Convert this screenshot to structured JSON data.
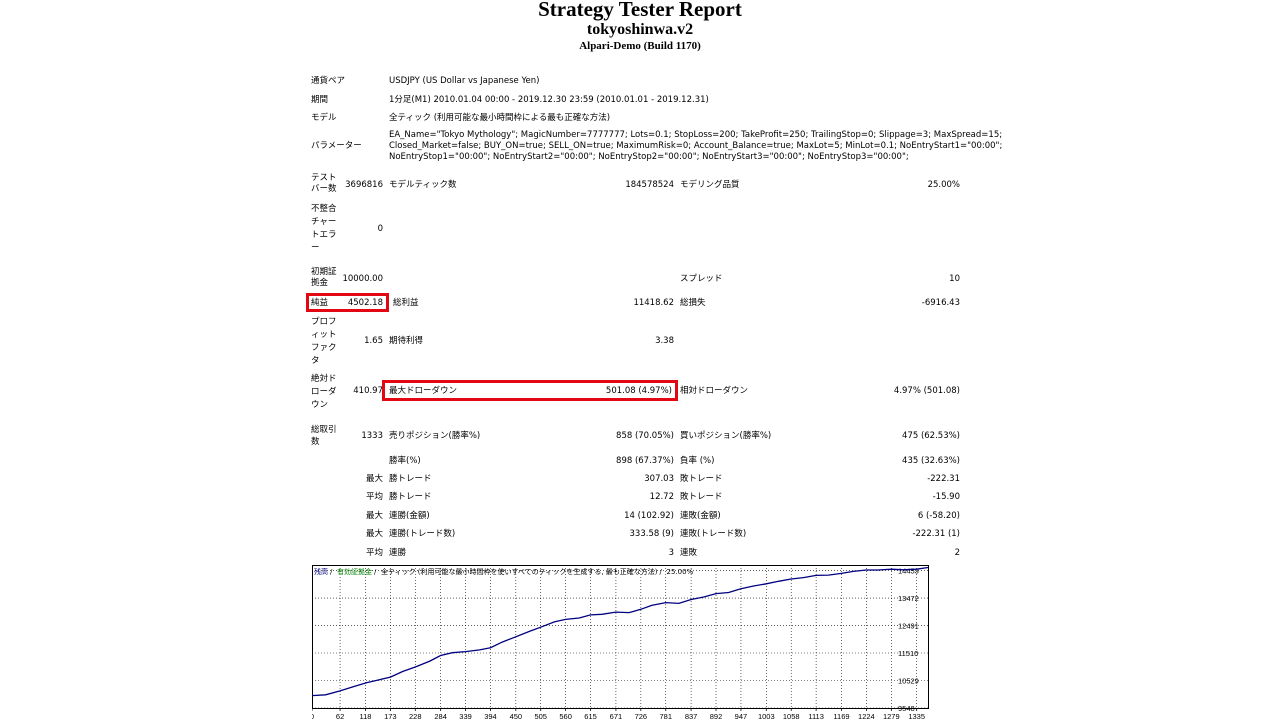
{
  "report": {
    "title": "Strategy Tester Report",
    "ea_name": "tokyoshinwa.v2",
    "server": "Alpari-Demo (Build 1170)"
  },
  "info": {
    "symbol_label": "通貨ペア",
    "symbol_value": "USDJPY (US Dollar vs Japanese Yen)",
    "period_label": "期間",
    "period_value": "1分足(M1) 2010.01.04 00:00 - 2019.12.30 23:59 (2010.01.01 - 2019.12.31)",
    "model_label": "モデル",
    "model_value": "全ティック (利用可能な最小時間枠による最も正確な方法)",
    "params_label": "パラメーター",
    "params_value": "EA_Name=\"Tokyo Mythology\"; MagicNumber=7777777; Lots=0.1; StopLoss=200; TakeProfit=250; TrailingStop=0; Slippage=3; MaxSpread=15;\nClosed_Market=false; BUY_ON=true; SELL_ON=true; MaximumRisk=0; Account_Balance=true; MaxLot=5; MinLot=0.1; NoEntryStart1=\"00:00\";\nNoEntryStop1=\"00:00\"; NoEntryStart2=\"00:00\"; NoEntryStop2=\"00:00\"; NoEntryStart3=\"00:00\"; NoEntryStop3=\"00:00\";"
  },
  "stats": {
    "bars_label": "テストバー数",
    "bars_value": "3696816",
    "ticks_label": "モデルティック数",
    "ticks_value": "184578524",
    "quality_label": "モデリング品質",
    "quality_value": "25.00%",
    "mismatch_label": "不整合チャートエラー",
    "mismatch_value": "0",
    "deposit_label": "初期証拠金",
    "deposit_value": "10000.00",
    "spread_label": "スプレッド",
    "spread_value": "10",
    "net_label": "純益",
    "net_value": "4502.18",
    "gross_profit_label": "総利益",
    "gross_profit_value": "11418.62",
    "gross_loss_label": "総損失",
    "gross_loss_value": "-6916.43",
    "pf_label": "プロフィットファクタ",
    "pf_value": "1.65",
    "expected_label": "期待利得",
    "expected_value": "3.38",
    "abs_dd_label": "絶対ドローダウン",
    "abs_dd_value": "410.97",
    "max_dd_label": "最大ドローダウン",
    "max_dd_value": "501.08 (4.97%)",
    "rel_dd_label": "相対ドローダウン",
    "rel_dd_value": "4.97% (501.08)",
    "trades_label": "総取引数",
    "trades_value": "1333",
    "short_label": "売りポジション(勝率%)",
    "short_value": "858 (70.05%)",
    "long_label": "買いポジション(勝率%)",
    "long_value": "475 (62.53%)",
    "win_label": "勝率(%)",
    "win_value": "898 (67.37%)",
    "loss_label": "負率 (%)",
    "loss_value": "435 (32.63%)",
    "max_prefix": "最大",
    "avg_prefix": "平均",
    "largest_win_label": "勝トレード",
    "largest_win_value": "307.03",
    "largest_loss_label": "敗トレード",
    "largest_loss_value": "-222.31",
    "avg_win_label": "勝トレード",
    "avg_win_value": "12.72",
    "avg_loss_label": "敗トレード",
    "avg_loss_value": "-15.90",
    "consec_wins_amt_label": "連勝(金額)",
    "consec_wins_amt_value": "14 (102.92)",
    "consec_loss_amt_label": "連敗(金額)",
    "consec_loss_amt_value": "6 (-58.20)",
    "consec_wins_cnt_label": "連勝(トレード数)",
    "consec_wins_cnt_value": "333.58 (9)",
    "consec_loss_cnt_label": "連敗(トレード数)",
    "consec_loss_cnt_value": "-222.31 (1)",
    "avg_consec_win_label": "連勝",
    "avg_consec_win_value": "3",
    "avg_consec_loss_label": "連敗",
    "avg_consec_loss_value": "2"
  },
  "chart_data": {
    "type": "line",
    "legend": [
      {
        "label": "残高",
        "color": "#000080"
      },
      {
        "label": "有効証拠金",
        "color": "#008000"
      },
      {
        "label": "全ティック (利用可能な最小時間枠を使いすべてのティックを生成する, 最も正確な方法)",
        "color": "#000000"
      },
      {
        "label": "25.00%",
        "color": "#000000"
      }
    ],
    "x_ticks": [
      0,
      62,
      118,
      173,
      228,
      284,
      339,
      394,
      450,
      505,
      560,
      615,
      671,
      726,
      781,
      837,
      892,
      947,
      1003,
      1058,
      1113,
      1169,
      1224,
      1279,
      1335
    ],
    "y_ticks": [
      9548,
      10529,
      11510,
      12491,
      13472,
      14453
    ],
    "xlim": [
      0,
      1360
    ],
    "ylim": [
      9548,
      14650
    ],
    "series": [
      {
        "color": "#000080",
        "x": [
          0,
          30,
          60,
          90,
          120,
          150,
          173,
          200,
          228,
          260,
          284,
          310,
          339,
          370,
          394,
          420,
          450,
          480,
          505,
          535,
          560,
          590,
          615,
          640,
          671,
          700,
          726,
          750,
          781,
          810,
          837,
          865,
          892,
          920,
          947,
          975,
          1003,
          1030,
          1058,
          1085,
          1113,
          1140,
          1169,
          1195,
          1224,
          1250,
          1279,
          1305,
          1335,
          1360
        ],
        "y": [
          9990,
          10020,
          10150,
          10300,
          10450,
          10560,
          10650,
          10850,
          11010,
          11220,
          11420,
          11520,
          11560,
          11620,
          11700,
          11900,
          12090,
          12280,
          12430,
          12620,
          12710,
          12760,
          12870,
          12890,
          12970,
          12950,
          13070,
          13210,
          13310,
          13280,
          13420,
          13510,
          13630,
          13670,
          13800,
          13900,
          13980,
          14070,
          14150,
          14200,
          14280,
          14290,
          14350,
          14420,
          14470,
          14470,
          14500,
          14480,
          14500,
          14560
        ]
      }
    ]
  }
}
